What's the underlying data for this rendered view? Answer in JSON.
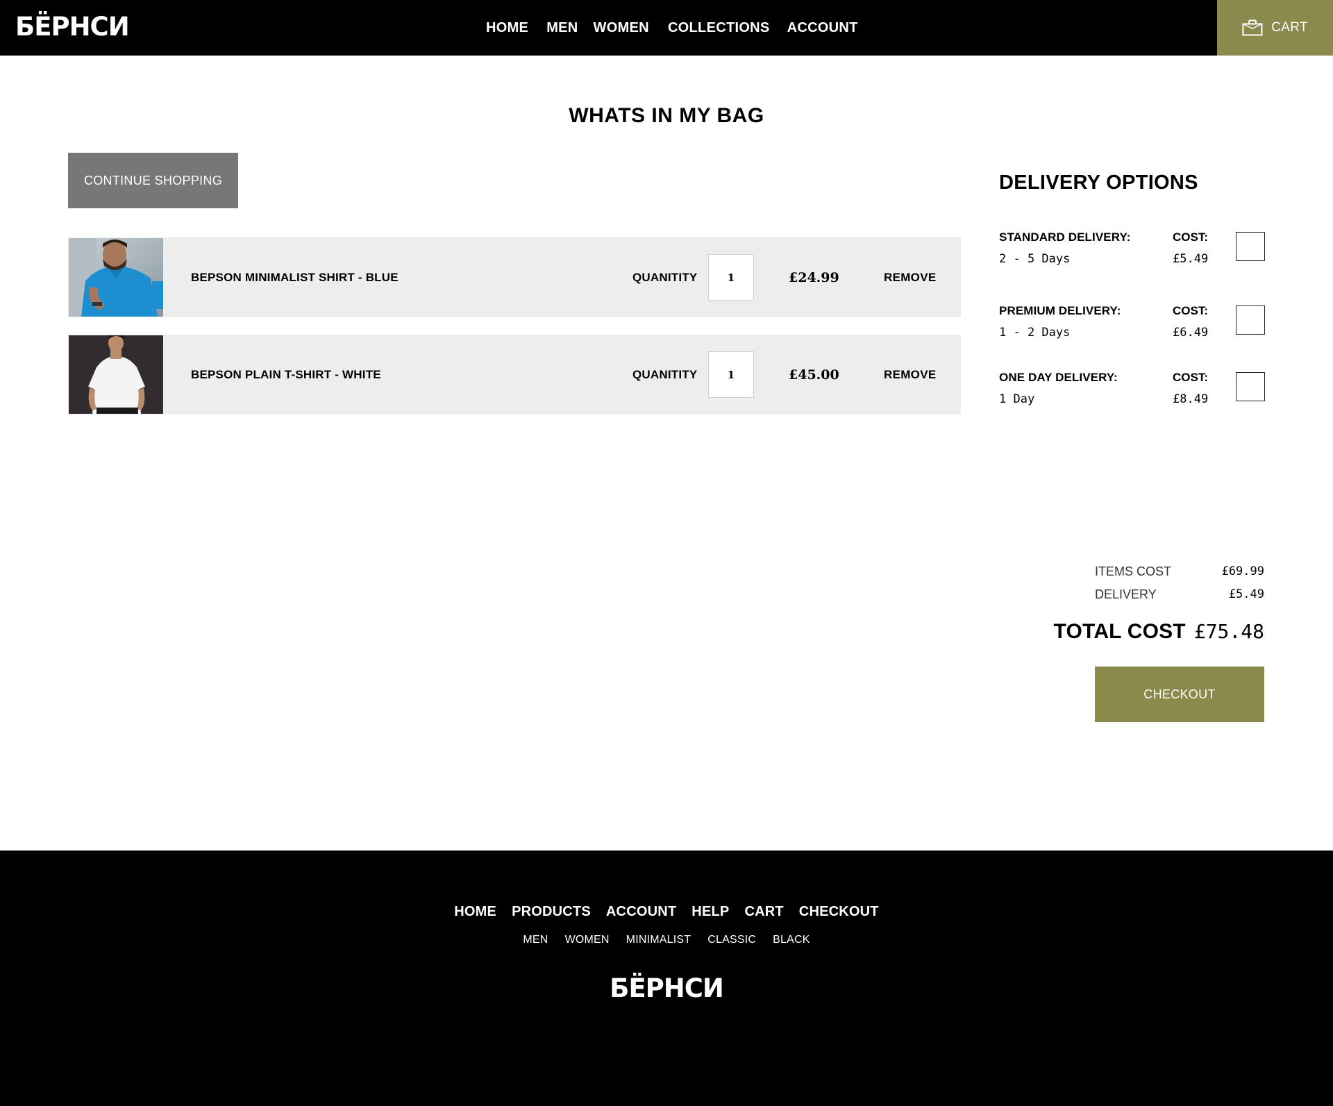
{
  "header": {
    "logo": "БЁРНСИ",
    "nav": [
      "HOME",
      "MEN",
      "WOMEN",
      "COLLECTIONS",
      "ACCOUNT"
    ],
    "cart_label": "CART"
  },
  "main": {
    "title": "WHATS IN MY BAG",
    "continue_label": "CONTINUE SHOPPING",
    "items": [
      {
        "name": "BEPSON MINIMALIST SHIRT - BLUE",
        "quantity_label": "QUANITITY",
        "quantity": "1",
        "price": "£24.99",
        "remove_label": "REMOVE"
      },
      {
        "name": "BEPSON PLAIN T-SHIRT - WHITE",
        "quantity_label": "QUANITITY",
        "quantity": "1",
        "price": "£45.00",
        "remove_label": "REMOVE"
      }
    ]
  },
  "delivery": {
    "title": "DELIVERY OPTIONS",
    "options": [
      {
        "name": "STANDARD DELIVERY:",
        "days": "2 - 5 Days",
        "cost_label": "COST:",
        "cost": "£5.49",
        "checked": false
      },
      {
        "name": "PREMIUM DELIVERY:",
        "days": "1 - 2 Days",
        "cost_label": "COST:",
        "cost": "£6.49",
        "checked": false
      },
      {
        "name": "ONE DAY DELIVERY:",
        "days": "1 Day",
        "cost_label": "COST:",
        "cost": "£8.49",
        "checked": false
      }
    ]
  },
  "summary": {
    "items_label": "ITEMS COST",
    "items_value": "£69.99",
    "delivery_label": "DELIVERY",
    "delivery_value": "£5.49",
    "total_label": "TOTAL COST",
    "total_value": "£75.48",
    "checkout_label": "CHECKOUT"
  },
  "footer": {
    "nav": [
      "HOME",
      "PRODUCTS",
      "ACCOUNT",
      "HELP",
      "CART",
      "CHECKOUT"
    ],
    "sub": [
      "MEN",
      "WOMEN",
      "MINIMALIST",
      "CLASSIC",
      "BLACK"
    ],
    "logo": "БЁРНСИ"
  },
  "colors": {
    "accent": "#8a8a4c",
    "header_bg": "#000000",
    "row_bg": "#ededed",
    "continue_bg": "#777777"
  },
  "icons": {
    "cart": "shopping-bag-icon"
  }
}
